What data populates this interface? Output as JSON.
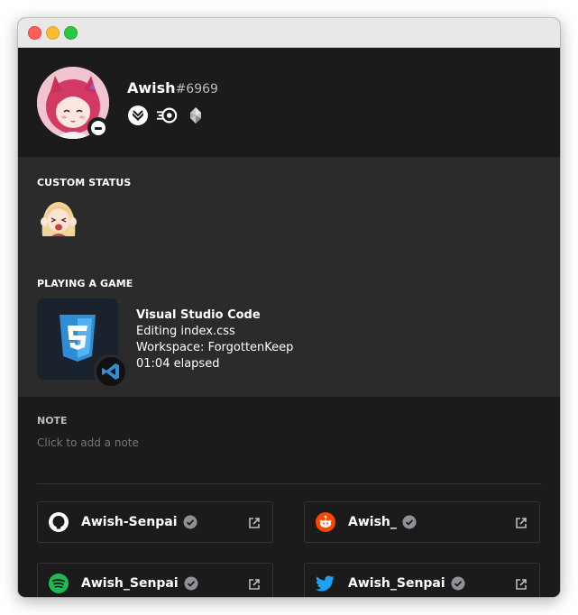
{
  "profile": {
    "username": "Awish",
    "discriminator": "#6969",
    "status": "do-not-disturb",
    "badges": [
      "hypesquad-bravery-icon",
      "nitro-boost-icon",
      "early-supporter-gem-icon"
    ]
  },
  "custom_status": {
    "label": "CUSTOM STATUS",
    "emoji": "anime-girl-emoji"
  },
  "activity": {
    "label": "PLAYING A GAME",
    "name": "Visual Studio Code",
    "details": "Editing index.css",
    "state": "Workspace: ForgottenKeep",
    "elapsed": "01:04 elapsed",
    "large_icon": "css3-icon",
    "small_icon": "vscode-icon"
  },
  "note": {
    "label": "NOTE",
    "placeholder": "Click to add a note"
  },
  "connections": [
    {
      "service": "github",
      "name": "Awish-Senpai",
      "color": "#ffffff"
    },
    {
      "service": "reddit",
      "name": "Awish_",
      "color": "#ff4500"
    },
    {
      "service": "spotify",
      "name": "Awish_Senpai",
      "color": "#1db954"
    },
    {
      "service": "twitter",
      "name": "Awish_Senpai",
      "color": "#1da1f2"
    }
  ],
  "colors": {
    "background": "#1b1b1b",
    "activity_bg": "#2b2b2b",
    "muted_text": "#b9bbbe",
    "placeholder": "#72767d"
  }
}
